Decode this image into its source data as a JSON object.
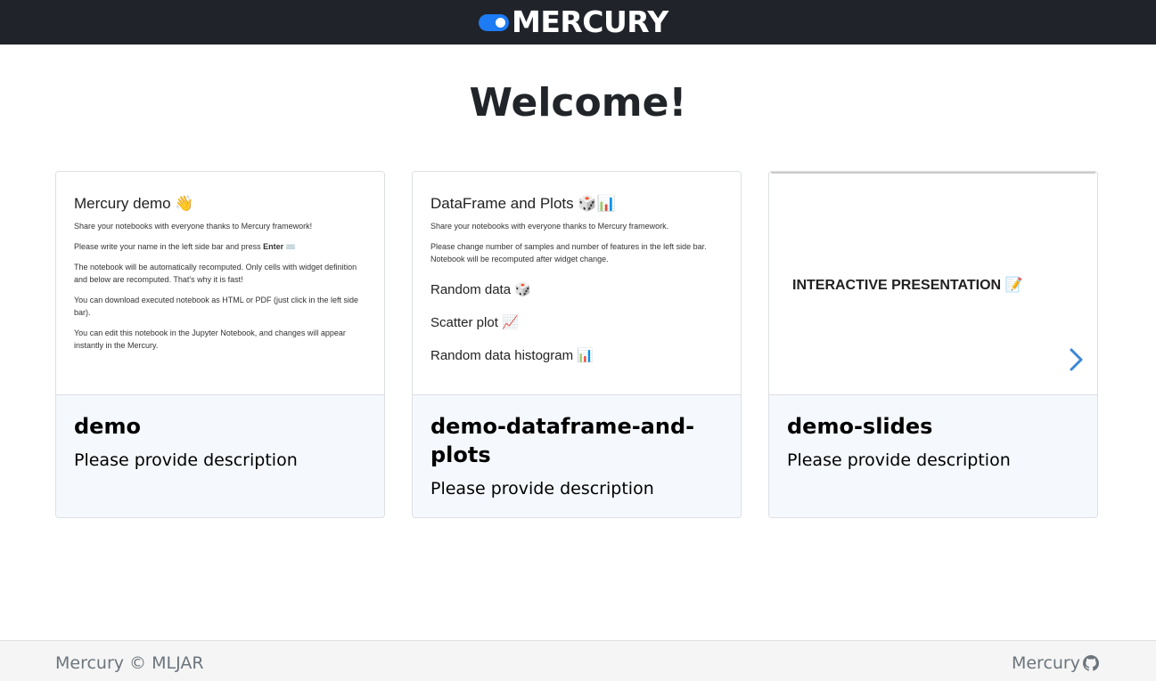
{
  "navbar": {
    "brand": "MERCURY",
    "accent_color": "#1d7bf4",
    "background": "#202329"
  },
  "page": {
    "heading": "Welcome!"
  },
  "cards": [
    {
      "title": "demo",
      "description": "Please provide description",
      "preview": {
        "heading": "Mercury demo 👋",
        "paragraphs": [
          "Share your notebooks with everyone thanks to Mercury framework!",
          "Please write your name in the left side bar and press",
          "The notebook will be automatically recomputed. Only cells with widget definition and below are recomputed. That's why it is fast!",
          "You can download executed notebook as HTML or PDF (just click in the left side bar).",
          "You can edit this notebook in the Jupyter Notebook, and changes will appear instantly in the Mercury."
        ],
        "enter_key": "Enter",
        "keyboard_emoji": "⌨️"
      }
    },
    {
      "title": "demo-dataframe-and-plots",
      "description": "Please provide description",
      "preview": {
        "heading": "DataFrame and Plots 🎲📊",
        "paragraphs": [
          "Share your notebooks with everyone thanks to Mercury framework.",
          "Please change number of samples and number of features in the left side bar. Notebook will be recomputed after widget change."
        ],
        "sections": [
          "Random data 🎲",
          "Scatter plot 📈",
          "Random data histogram 📊"
        ]
      }
    },
    {
      "title": "demo-slides",
      "description": "Please provide description",
      "preview": {
        "slide_title": "INTERACTIVE PRESENTATION 📝",
        "arrow_icon": "chevron-right-icon",
        "arrow_color": "#3b86d6"
      }
    }
  ],
  "footer": {
    "left": "Mercury © MLJAR",
    "right": "Mercury",
    "right_icon": "github-icon"
  }
}
